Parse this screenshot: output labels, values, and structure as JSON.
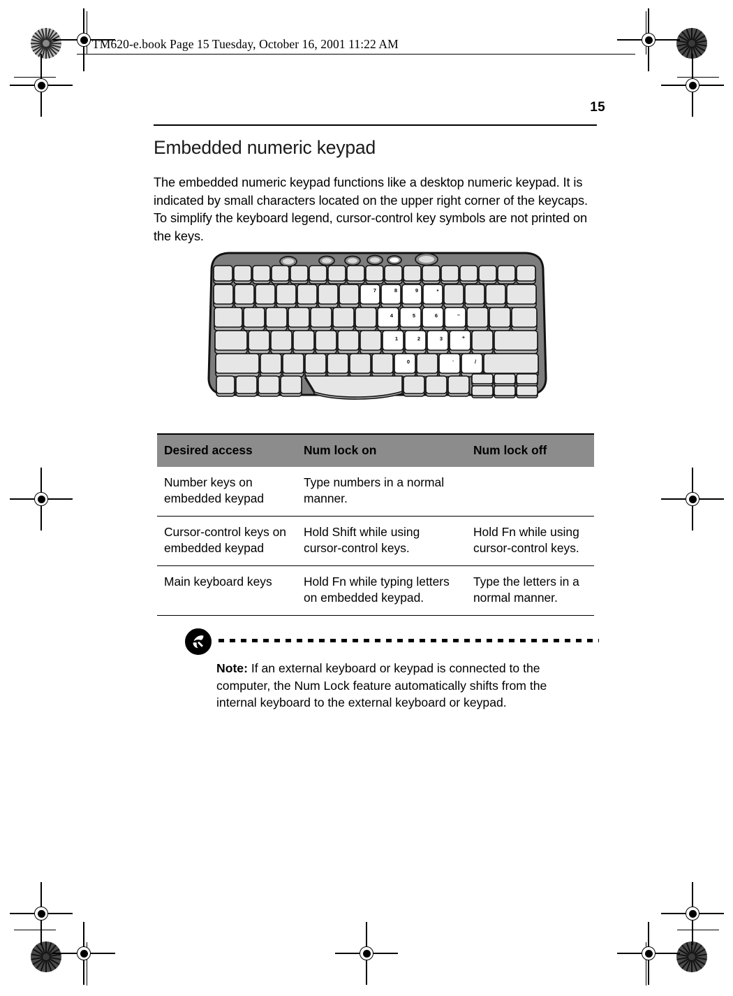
{
  "print_header": {
    "text": "TM620-e.book  Page 15  Tuesday, October 16, 2001  11:22 AM"
  },
  "page": {
    "folio": "15"
  },
  "section": {
    "heading": "Embedded numeric keypad",
    "paragraph": "The embedded numeric keypad functions like a desktop numeric keypad.  It is indicated by small characters located on the upper right corner of the keycaps.  To simplify the keyboard legend, cursor-control key symbols are not printed on the keys."
  },
  "figure": {
    "caption": "",
    "alt": "notebook keyboard with embedded numeric keypad keys highlighted",
    "keypad_keys": {
      "row1": [
        "7",
        "8",
        "9",
        "*"
      ],
      "row2": [
        "4",
        "5",
        "6",
        "–"
      ],
      "row3": [
        "1",
        "2",
        "3",
        "+"
      ],
      "row4": [
        "0",
        ".",
        "/"
      ]
    },
    "colors": {
      "bezel": "#7d7d7d",
      "key_face": "#e3e3e3",
      "key_shadow": "#b0b0b0",
      "highlight_key": "#ffffff",
      "outline": "#1a1a1a"
    }
  },
  "table": {
    "headers": [
      "Desired access",
      "Num lock on",
      "Num lock off"
    ],
    "header_bg": "#8c8c8c",
    "rows": [
      {
        "access": "Number keys on embedded keypad",
        "num_lock_on": "Type numbers in a normal manner.",
        "num_lock_off": ""
      },
      {
        "access": "Cursor-control keys on embedded keypad",
        "num_lock_on": "Hold Shift while using cursor-control keys.",
        "num_lock_off": "Hold Fn while using cursor-control keys."
      },
      {
        "access": "Main keyboard keys",
        "num_lock_on": "Hold Fn while typing letters on embedded keypad.",
        "num_lock_off": "Type the letters in a normal manner."
      }
    ]
  },
  "note": {
    "label": "Note:",
    "body": " If an external keyboard or keypad is connected to the computer, the Num Lock feature automatically shifts from the internal keyboard to the external keyboard or keypad.",
    "icon": "note-pen-icon"
  }
}
